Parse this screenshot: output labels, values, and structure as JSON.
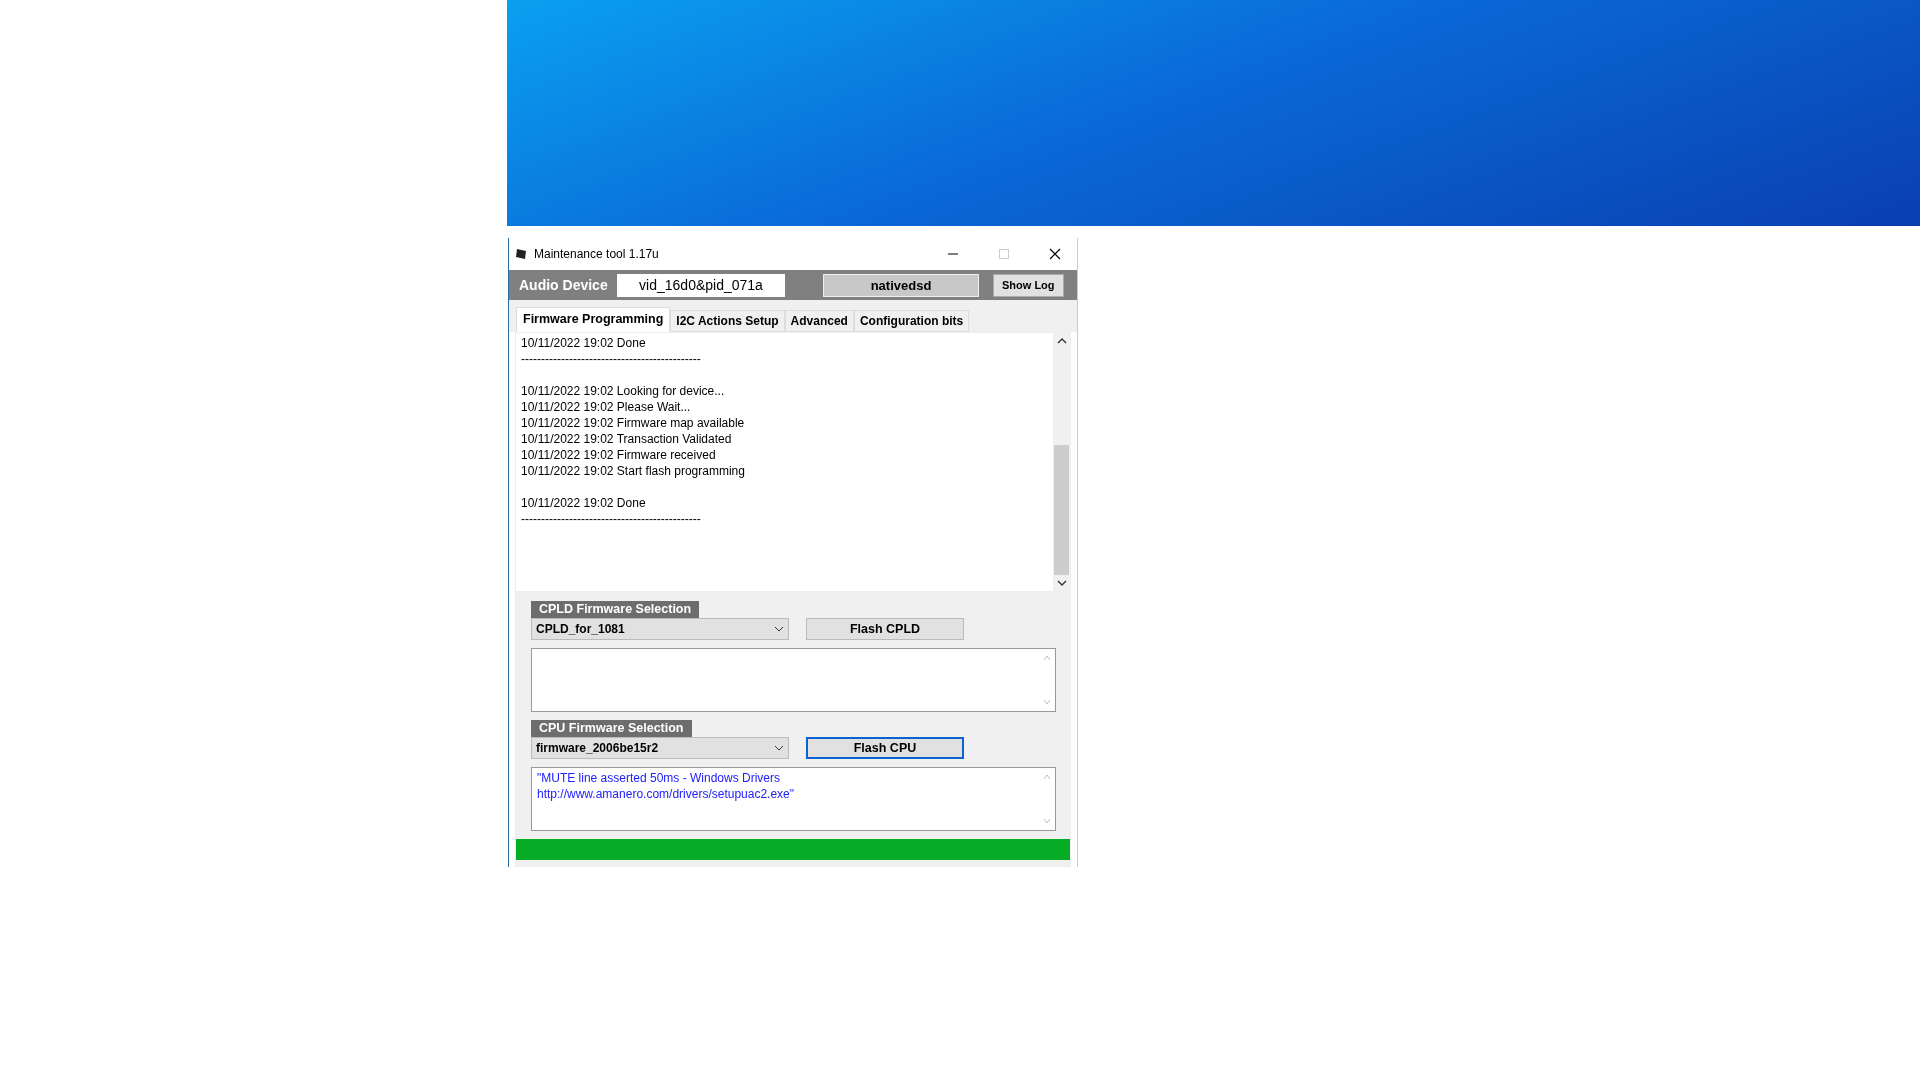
{
  "window": {
    "title": "Maintenance tool 1.17u"
  },
  "device_bar": {
    "label": "Audio Device",
    "device_id": "vid_16d0&pid_071a",
    "mode": "nativedsd",
    "show_log_button": "Show Log"
  },
  "tabs": [
    {
      "label": "Firmware Programming",
      "selected": true
    },
    {
      "label": "I2C Actions Setup",
      "selected": false
    },
    {
      "label": "Advanced",
      "selected": false
    },
    {
      "label": "Configuration bits",
      "selected": false
    }
  ],
  "log": {
    "blocks": [
      {
        "lines": [
          "10/11/2022 19:02 Done",
          "---------------------------------------------"
        ]
      },
      {
        "lines": [
          "10/11/2022 19:02 Looking for device...",
          "10/11/2022 19:02 Please Wait...",
          "10/11/2022 19:02 Firmware map available",
          "10/11/2022 19:02 Transaction Validated",
          "10/11/2022 19:02 Firmware received",
          "10/11/2022 19:02 Start flash programming"
        ]
      },
      {
        "lines": [
          "10/11/2022 19:02 Done",
          "---------------------------------------------"
        ]
      }
    ]
  },
  "sections": [
    {
      "title": "CPLD Firmware Selection",
      "selection": "CPLD_for_1081",
      "button": "Flash CPLD",
      "focused": false
    },
    {
      "title": "CPU Firmware Selection",
      "selection": "firmware_2006be15r2",
      "button": "Flash CPU",
      "focused": true,
      "notes": [
        "\"MUTE line asserted 50ms - Windows Drivers",
        "http://www.amanero.com/drivers/setupuac2.exe\""
      ]
    }
  ],
  "progress": {
    "level": 1
  }
}
